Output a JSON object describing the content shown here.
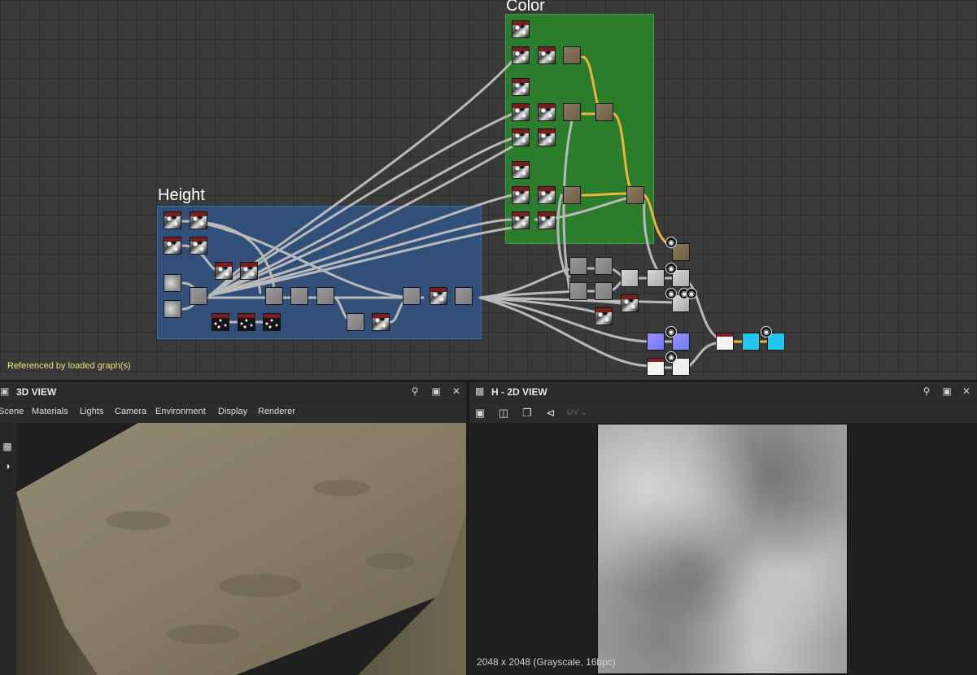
{
  "graph": {
    "frames": {
      "height": {
        "title": "Height",
        "color": "#2e568c"
      },
      "color": {
        "title": "Color",
        "color": "#288c28"
      }
    },
    "status_note": "Referenced by loaded graph(s)",
    "wire_colors": {
      "default": "#b9b9b9",
      "highlight": "#f0b43c"
    }
  },
  "panel_3d": {
    "title": "3D VIEW",
    "icon": "cube-icon",
    "menu": [
      "Scene",
      "Materials",
      "Lights",
      "Camera",
      "Environment",
      "Display",
      "Renderer"
    ],
    "tools": [
      "camera-icon",
      "light-bulb-icon"
    ]
  },
  "panel_2d": {
    "title": "H - 2D VIEW",
    "icon": "checker-icon",
    "toolbar": [
      "fit-view-icon",
      "save-icon",
      "copy-icon",
      "share-icon"
    ],
    "uv_label": "UV",
    "info": "2048 x 2048 (Grayscale, 16bpc)"
  },
  "panel_buttons": [
    "pin-icon",
    "maximize-icon",
    "close-icon"
  ]
}
